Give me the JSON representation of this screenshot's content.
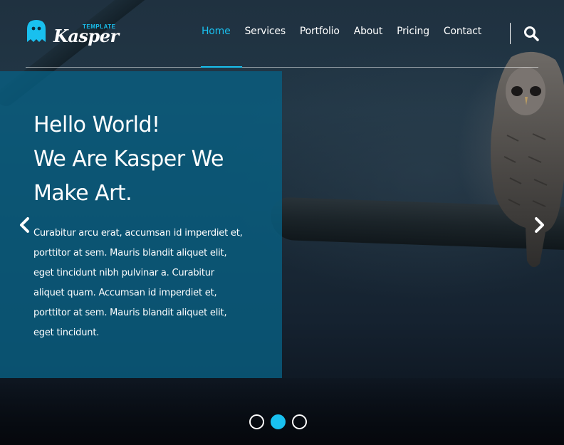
{
  "brand": {
    "name": "Kasper",
    "tagline": "TEMPLATE",
    "accent_color": "#19c0ef",
    "logo_icon": "ghost-icon"
  },
  "nav": {
    "items": [
      {
        "label": "Home",
        "active": true
      },
      {
        "label": "Services",
        "active": false
      },
      {
        "label": "Portfolio",
        "active": false
      },
      {
        "label": "About",
        "active": false
      },
      {
        "label": "Pricing",
        "active": false
      },
      {
        "label": "Contact",
        "active": false
      }
    ],
    "search_icon": "search-icon"
  },
  "hero": {
    "title_lines": [
      "Hello World!",
      "We Are Kasper We",
      "Make Art."
    ],
    "text": "Curabitur arcu erat, accumsan id imperdiet et, porttitor at sem. Mauris blandit aliquet elit, eget tincidunt nibh pulvinar a. Curabitur aliquet quam. Accumsan id imperdiet et, porttitor at sem. Mauris blandit aliquet elit, eget tincidunt.",
    "panel_color": "#085e80",
    "prev_icon": "chevron-left-icon",
    "next_icon": "chevron-right-icon"
  },
  "slider": {
    "bullets": [
      {
        "active": false
      },
      {
        "active": true
      },
      {
        "active": false
      }
    ]
  }
}
